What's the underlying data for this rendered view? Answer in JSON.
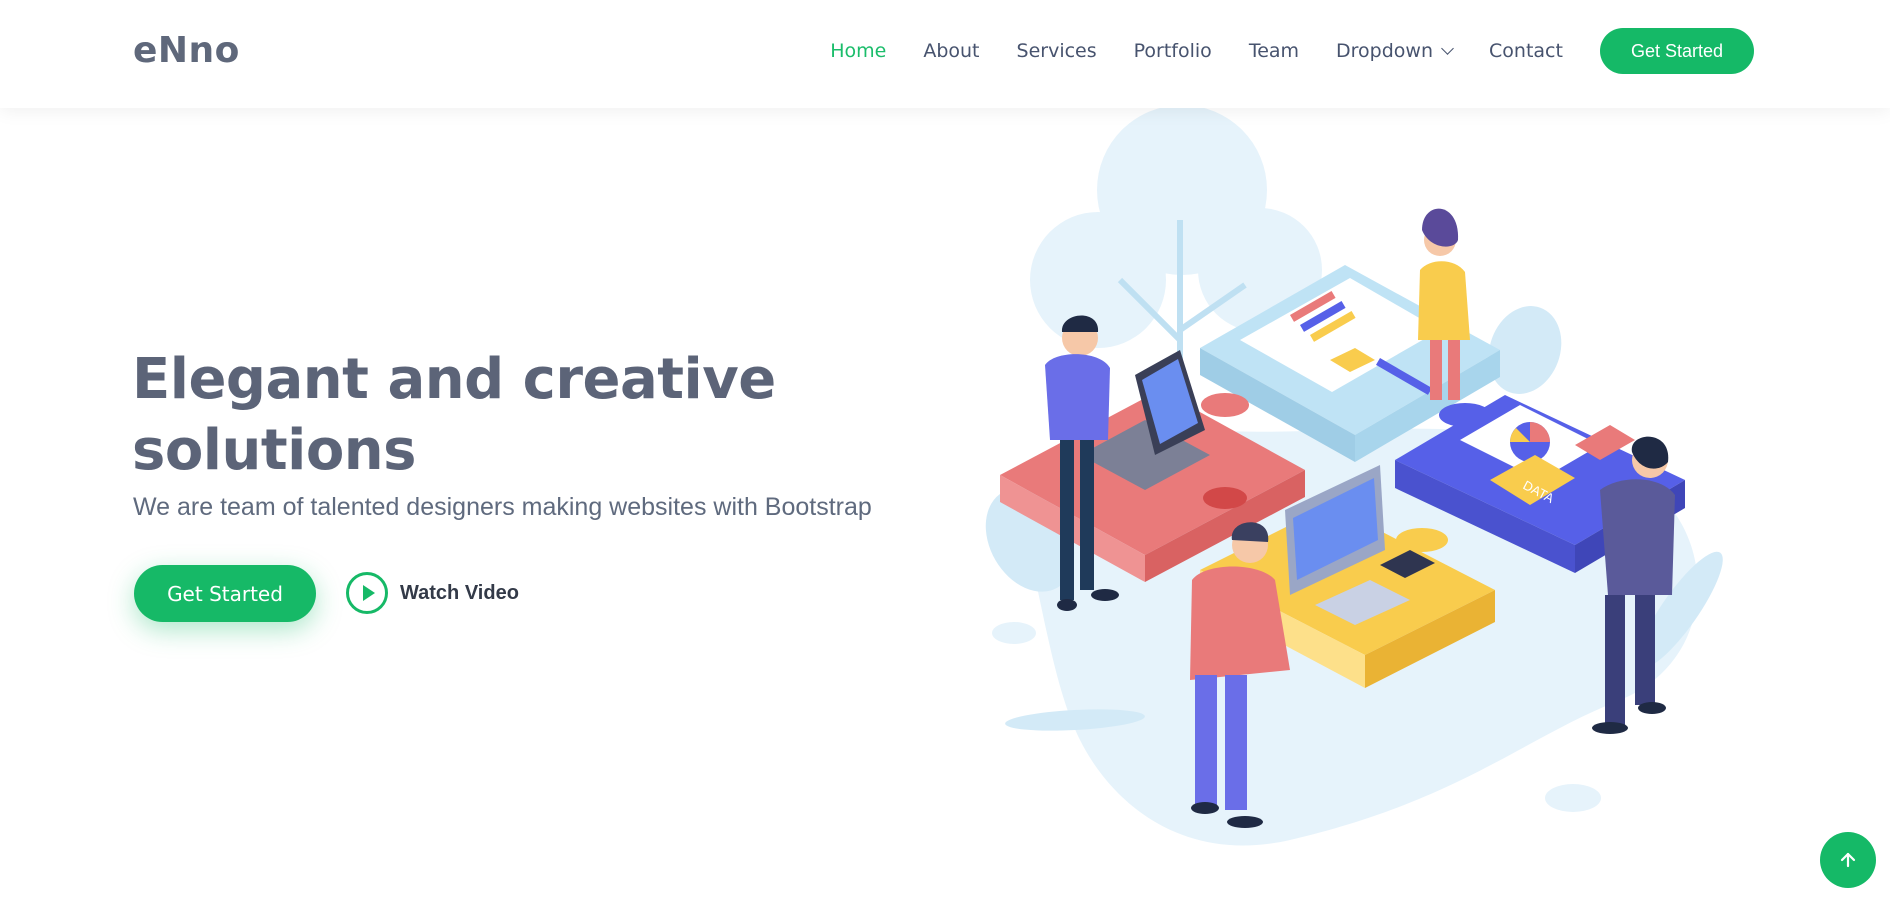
{
  "header": {
    "logo": "eNno",
    "nav": [
      {
        "label": "Home",
        "active": true
      },
      {
        "label": "About"
      },
      {
        "label": "Services"
      },
      {
        "label": "Portfolio"
      },
      {
        "label": "Team"
      },
      {
        "label": "Dropdown",
        "has_dropdown": true
      },
      {
        "label": "Contact"
      }
    ],
    "cta_label": "Get Started"
  },
  "hero": {
    "title": "Elegant and creative solutions",
    "subtitle": "We are team of talented designers making websites with Bootstrap",
    "primary_button": "Get Started",
    "video_label": "Watch Video",
    "illustration_tag": "DATA"
  },
  "back_to_top_icon": "arrow-up-icon",
  "colors": {
    "accent": "#16b967",
    "heading": "#5c6478",
    "text": "#5f6a7e",
    "puzzle_red": "#e97a7a",
    "puzzle_blue": "#5660e8",
    "puzzle_yellow": "#f9cc4d",
    "puzzle_light": "#bfe3f5"
  }
}
